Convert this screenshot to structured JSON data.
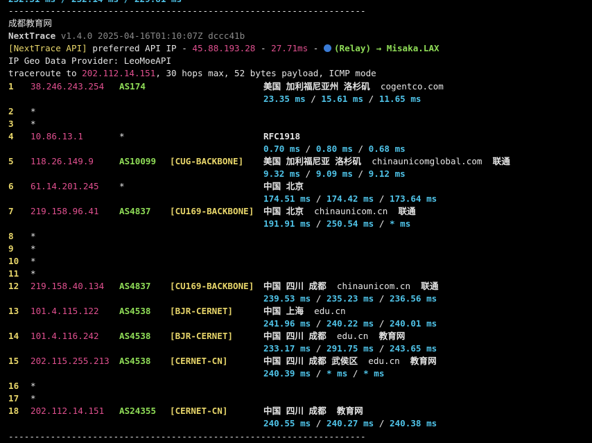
{
  "top_cut_rtt": "232.31 ms / 232.14 ms / 229.81 ms",
  "divider": "--------------------------------------------------------------------",
  "title": "成都教育网",
  "version": {
    "name": "NextTrace",
    "rest": " v1.4.0 2025-04-16T01:10:07Z dccc41b"
  },
  "api_line": {
    "prefix": "[NextTrace API]",
    "text1": " preferred API IP - ",
    "ip": "45.88.193.28",
    "dash1": " - ",
    "latency": "27.71ms",
    "dash2": " - ",
    "relay": "(Relay) → Misaka.LAX"
  },
  "provider": "IP Geo Data Provider: LeoMoeAPI",
  "traceroute": {
    "prefix": "traceroute to ",
    "ip": "202.112.14.151",
    "suffix": ", 30 hops max, 52 bytes payload, ICMP mode"
  },
  "hops": [
    {
      "n": "1",
      "ip": "38.246.243.254",
      "asn": "AS174",
      "tag": "",
      "geo": "美国 加利福尼亚州 洛杉矶",
      "host": "cogentco.com",
      "isp": "",
      "rtt": "23.35 ms / 15.61 ms / 11.65 ms"
    },
    {
      "n": "2",
      "star": "*"
    },
    {
      "n": "3",
      "star": "*"
    },
    {
      "n": "4",
      "ip": "10.86.13.1",
      "asn": "*",
      "tag": "",
      "geo": "RFC1918",
      "host": "",
      "isp": "",
      "rtt": "0.70 ms / 0.80 ms / 0.68 ms"
    },
    {
      "n": "5",
      "ip": "118.26.149.9",
      "asn": "AS10099",
      "tag": "[CUG-BACKBONE]",
      "geo": "美国 加利福尼亚 洛杉矶",
      "host": "chinaunicomglobal.com",
      "isp": "联通",
      "rtt": "9.32 ms / 9.09 ms / 9.12 ms"
    },
    {
      "n": "6",
      "ip": "61.14.201.245",
      "asn": "*",
      "tag": "",
      "geo": "中国 北京",
      "host": "",
      "isp": "",
      "rtt": "174.51 ms / 174.42 ms / 173.64 ms"
    },
    {
      "n": "7",
      "ip": "219.158.96.41",
      "asn": "AS4837",
      "tag": "[CU169-BACKBONE]",
      "geo": "中国 北京",
      "host": "chinaunicom.cn",
      "isp": "联通",
      "rtt": "191.91 ms / 250.54 ms / * ms"
    },
    {
      "n": "8",
      "star": "*"
    },
    {
      "n": "9",
      "star": "*"
    },
    {
      "n": "10",
      "star": "*"
    },
    {
      "n": "11",
      "star": "*"
    },
    {
      "n": "12",
      "ip": "219.158.40.134",
      "asn": "AS4837",
      "tag": "[CU169-BACKBONE]",
      "geo": "中国 四川 成都",
      "host": "chinaunicom.cn",
      "isp": "联通",
      "rtt": "239.53 ms / 235.23 ms / 236.56 ms"
    },
    {
      "n": "13",
      "ip": "101.4.115.122",
      "asn": "AS4538",
      "tag": "[BJR-CERNET]",
      "geo": "中国 上海",
      "host": "edu.cn",
      "isp": "",
      "rtt": "241.96 ms / 240.22 ms / 240.01 ms"
    },
    {
      "n": "14",
      "ip": "101.4.116.242",
      "asn": "AS4538",
      "tag": "[BJR-CERNET]",
      "geo": "中国 四川 成都",
      "host": "edu.cn",
      "isp": "教育网",
      "rtt": "233.17 ms / 291.75 ms / 243.65 ms"
    },
    {
      "n": "15",
      "ip": "202.115.255.213",
      "asn": "AS4538",
      "tag": "[CERNET-CN]",
      "geo": "中国 四川 成都 武侯区",
      "host": "edu.cn",
      "isp": "教育网",
      "rtt": "240.39 ms / * ms / * ms"
    },
    {
      "n": "16",
      "star": "*"
    },
    {
      "n": "17",
      "star": "*"
    },
    {
      "n": "18",
      "ip": "202.112.14.151",
      "asn": "AS24355",
      "tag": "[CERNET-CN]",
      "geo": "中国 四川 成都",
      "host": "",
      "isp": "教育网",
      "rtt": "240.55 ms / 240.27 ms / 240.38 ms"
    }
  ],
  "colors": {
    "background": "#000000",
    "ip": "#e0508f",
    "asn": "#8fdc57",
    "tag": "#e8d66a",
    "rtt": "#4fc3e8"
  }
}
